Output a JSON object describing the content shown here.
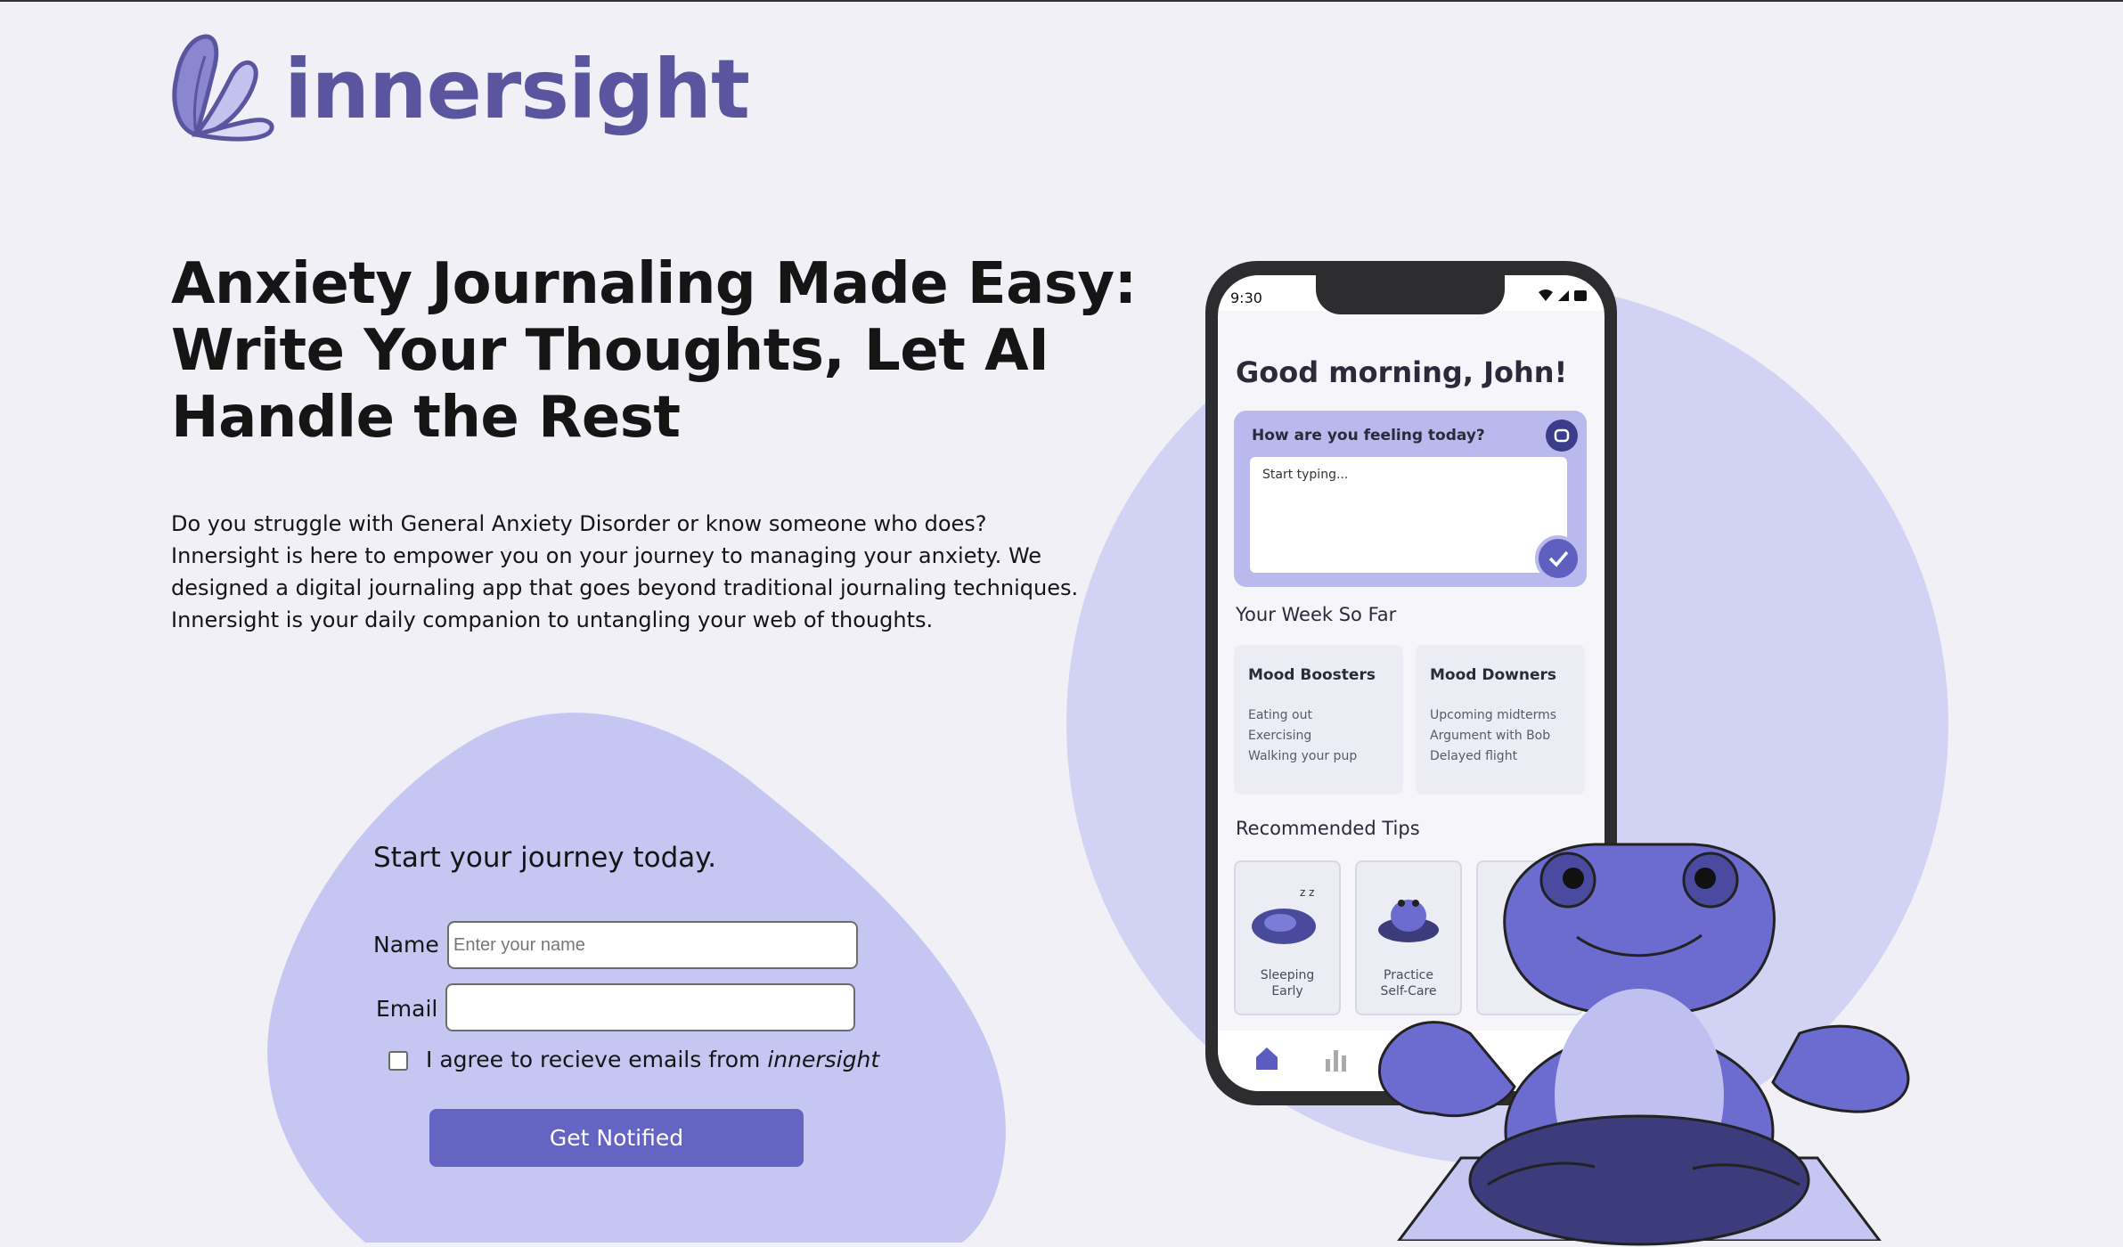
{
  "brand": {
    "name": "innersight"
  },
  "hero": {
    "headline_lines": [
      "Anxiety Journaling Made Easy:",
      "Write Your Thoughts, Let AI",
      "Handle the Rest"
    ],
    "intro_lines": [
      "Do you struggle with General Anxiety Disorder or know someone who does?",
      "Innersight is here to empower you on your journey to managing your anxiety. We",
      "designed a digital journaling app that goes beyond traditional journaling techniques.",
      "Innersight is your daily companion to untangling your web of thoughts."
    ]
  },
  "signup": {
    "title": "Start your journey today.",
    "name_label": "Name",
    "name_placeholder": "Enter your name",
    "name_value": "",
    "email_label": "Email",
    "email_value": "",
    "consent_prefix": "I agree to recieve emails from ",
    "consent_brand": "innersight",
    "consent_checked": false,
    "button_label": "Get Notified"
  },
  "phone": {
    "time": "9:30",
    "greeting": "Good morning, John!",
    "feeling_question": "How are you feeling today?",
    "feeling_placeholder": "Start typing...",
    "week_title": "Your Week So Far",
    "boosters": {
      "title": "Mood Boosters",
      "items": [
        "Eating out",
        "Exercising",
        "Walking your pup"
      ]
    },
    "downers": {
      "title": "Mood Downers",
      "items": [
        "Upcoming midterms",
        "Argument with Bob",
        "Delayed flight"
      ]
    },
    "tips_title": "Recommended Tips",
    "tips": [
      {
        "line1": "Sleeping",
        "line2": "Early"
      },
      {
        "line1": "Practice",
        "line2": "Self-Care"
      }
    ],
    "nav_icons": [
      "home-icon",
      "stats-icon"
    ]
  },
  "colors": {
    "background": "#f0f0f6",
    "brand_purple": "#5b55a0",
    "button": "#6464c2",
    "blob": "#c6c6f3",
    "circle": "#d2d2f5"
  }
}
